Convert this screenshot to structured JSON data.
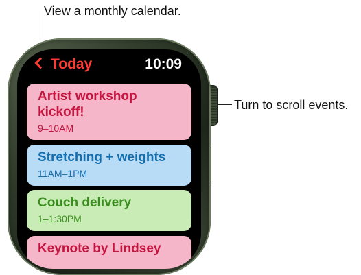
{
  "callouts": {
    "calendar": "View a monthly calendar.",
    "scroll": "Turn to scroll events."
  },
  "status_bar": {
    "back_label": "Today",
    "time": "10:09"
  },
  "events": [
    {
      "title": "Artist workshop kickoff!",
      "time": "9–10AM",
      "color": "#f4b6c8"
    },
    {
      "title": "Stretching + weights",
      "time": "11AM–1PM",
      "color": "#b8dcf6"
    },
    {
      "title": "Couch delivery",
      "time": "1–1:30PM",
      "color": "#c9ecb7"
    },
    {
      "title": "Keynote by Lindsey",
      "time": "",
      "color": "#f4b6c8"
    }
  ],
  "colors": {
    "accent_red": "#ff3b30",
    "screen_bg": "#000000"
  }
}
